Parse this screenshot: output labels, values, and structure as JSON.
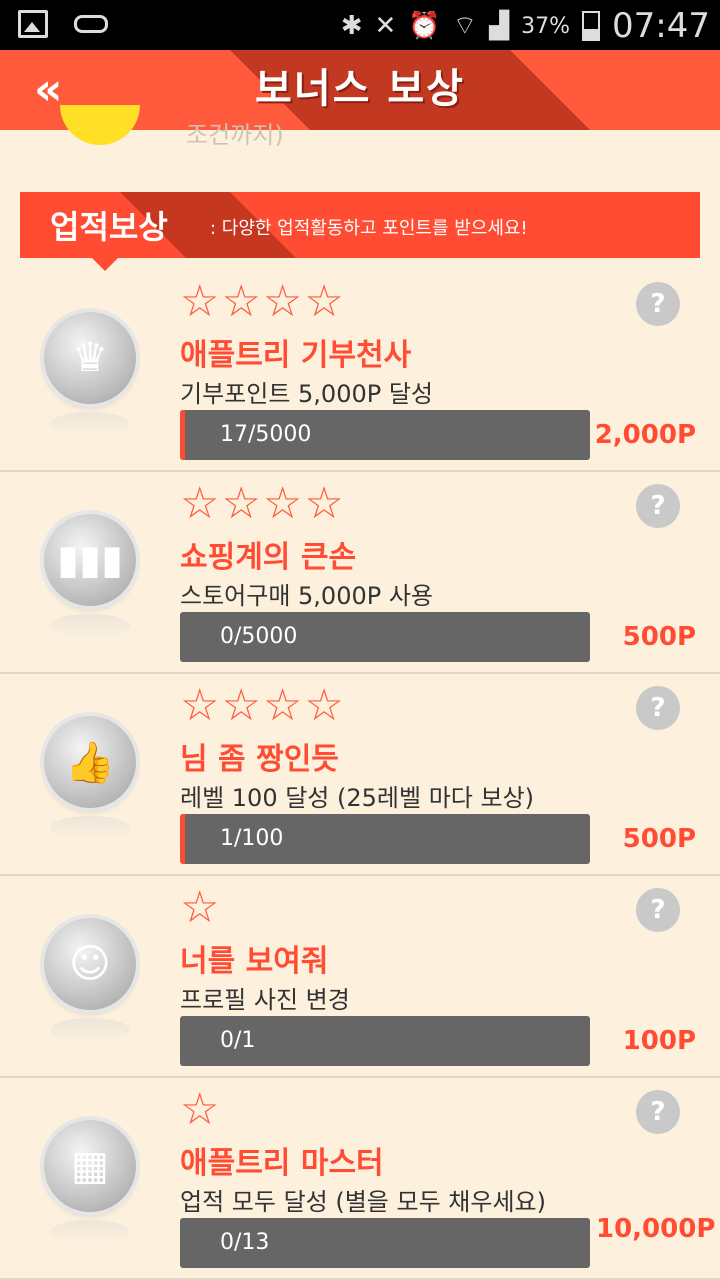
{
  "status_bar": {
    "battery": "37%",
    "time": "07:47",
    "icons": [
      "gallery-icon",
      "drive-icon",
      "bluetooth-icon",
      "mute-icon",
      "alarm-icon",
      "wifi-icon",
      "signal-icon",
      "battery-icon"
    ]
  },
  "header": {
    "back": "«",
    "title": "보너스 보상"
  },
  "cutoff": {
    "text": "조건까지)"
  },
  "section": {
    "title": "업적보상",
    "subtitle": ": 다양한 업적활동하고 포인트를 받으세요!"
  },
  "colors": {
    "accent": "#ff4c33",
    "background": "#fdf1de",
    "bar": "#666666"
  },
  "achievements": [
    {
      "stars": "☆☆☆☆",
      "help": "?",
      "title": "애플트리 기부천사",
      "desc": "기부포인트 5,000P 달성",
      "progress_text": "17/5000",
      "progress_fraction": 0.0034,
      "reward": "2,000P",
      "badge_icon": "crown-icon"
    },
    {
      "stars": "☆☆☆☆",
      "help": "?",
      "title": "쇼핑계의 큰손",
      "desc": "스토어구매 5,000P 사용",
      "progress_text": "0/5000",
      "progress_fraction": 0,
      "reward": "500P",
      "badge_icon": "bar-chart-icon"
    },
    {
      "stars": "☆☆☆☆",
      "help": "?",
      "title": "님 좀 짱인듯",
      "desc": "레벨 100 달성 (25레벨 마다 보상)",
      "progress_text": "1/100",
      "progress_fraction": 0.01,
      "reward": "500P",
      "badge_icon": "thumbs-up-icon"
    },
    {
      "stars": "☆",
      "help": "?",
      "title": "너를 보여줘",
      "desc": "프로필 사진 변경",
      "progress_text": "0/1",
      "progress_fraction": 0,
      "reward": "100P",
      "badge_icon": "smile-sun-icon"
    },
    {
      "stars": "☆",
      "help": "?",
      "title": "애플트리 마스터",
      "desc": "업적 모두 달성 (별을 모두 채우세요)",
      "progress_text": "0/13",
      "progress_fraction": 0,
      "reward": "10,000P",
      "badge_icon": "document-icon"
    }
  ]
}
